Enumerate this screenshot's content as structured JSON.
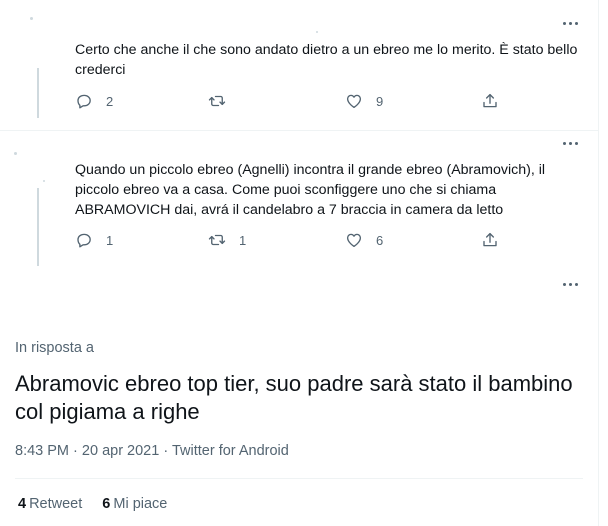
{
  "replies": [
    {
      "text": "Certo che anche il che sono andato dietro a un ebreo me lo merito. È stato bello crederci",
      "reply_count": "2",
      "retweet_count": "",
      "like_count": "9"
    },
    {
      "text": "Quando un piccolo ebreo (Agnelli) incontra il grande ebreo (Abramovich), il piccolo ebreo va a casa. Come puoi sconfiggere uno che si chiama ABRAMOVICH dai, avrá il candelabro a 7 braccia in camera da letto",
      "reply_count": "1",
      "retweet_count": "1",
      "like_count": "6"
    }
  ],
  "main_tweet": {
    "reply_to_label": "In risposta a",
    "text": "Abramovic ebreo top tier, suo padre sarà stato il bambino col pigiama a righe",
    "time": "8:43 PM",
    "separator": "·",
    "date": "20 apr 2021",
    "source": "Twitter for Android",
    "retweets_count": "4",
    "retweets_label": "Retweet",
    "likes_count": "6",
    "likes_label": "Mi piace"
  },
  "icons": {
    "reply": "reply-icon",
    "retweet": "retweet-icon",
    "like": "heart-icon",
    "share": "share-icon",
    "more": "more-icon"
  },
  "colors": {
    "text_primary": "#0f1419",
    "text_secondary": "#536471",
    "divider": "#eff3f4",
    "thread_line": "#cfd9de"
  }
}
